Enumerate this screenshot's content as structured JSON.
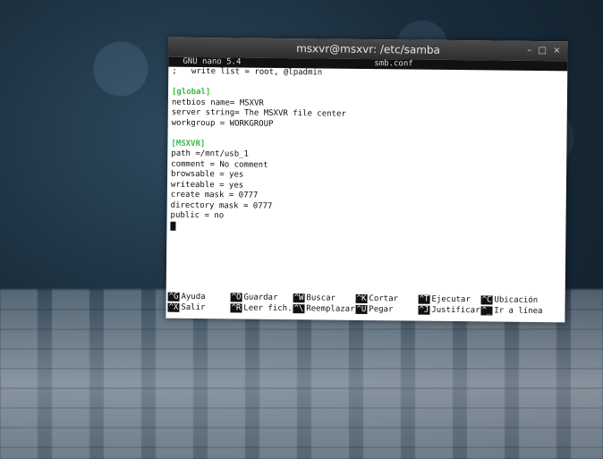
{
  "window": {
    "title": "msxvr@msxvr: /etc/samba",
    "controls": "– □ ×"
  },
  "nano": {
    "version": "GNU nano 5.4",
    "filename": "smb.conf"
  },
  "lines": [
    {
      "text": ";   write list = root, @lpadmin",
      "type": "normal"
    },
    {
      "text": "",
      "type": "normal"
    },
    {
      "text": "[global]",
      "type": "section"
    },
    {
      "text": "netbios name= MSXVR",
      "type": "normal"
    },
    {
      "text": "server string= The MSXVR file center",
      "type": "normal"
    },
    {
      "text": "workgroup = WORKGROUP",
      "type": "normal"
    },
    {
      "text": "",
      "type": "normal"
    },
    {
      "text": "[MSXVR]",
      "type": "section"
    },
    {
      "text": "path =/mnt/usb_1",
      "type": "normal"
    },
    {
      "text": "comment = No comment",
      "type": "normal"
    },
    {
      "text": "browsable = yes",
      "type": "normal"
    },
    {
      "text": "writeable = yes",
      "type": "normal"
    },
    {
      "text": "create mask = 0777",
      "type": "normal"
    },
    {
      "text": "directory mask = 0777",
      "type": "normal"
    },
    {
      "text": "public = no",
      "type": "normal"
    }
  ],
  "shortcuts": [
    [
      {
        "key": "^G",
        "label": "Ayuda"
      },
      {
        "key": "^X",
        "label": "Salir"
      }
    ],
    [
      {
        "key": "^O",
        "label": "Guardar"
      },
      {
        "key": "^R",
        "label": "Leer fich."
      }
    ],
    [
      {
        "key": "^W",
        "label": "Buscar"
      },
      {
        "key": "^\\",
        "label": "Reemplazar"
      }
    ],
    [
      {
        "key": "^K",
        "label": "Cortar"
      },
      {
        "key": "^U",
        "label": "Pegar"
      }
    ],
    [
      {
        "key": "^T",
        "label": "Ejecutar"
      },
      {
        "key": "^J",
        "label": "Justificar"
      }
    ],
    [
      {
        "key": "^C",
        "label": "Ubicación"
      },
      {
        "key": "^_",
        "label": "Ir a línea"
      }
    ]
  ],
  "colors": {
    "section": "#3ab84a",
    "terminal_bg": "#ffffff",
    "titlebar": "#3a3a3a"
  }
}
